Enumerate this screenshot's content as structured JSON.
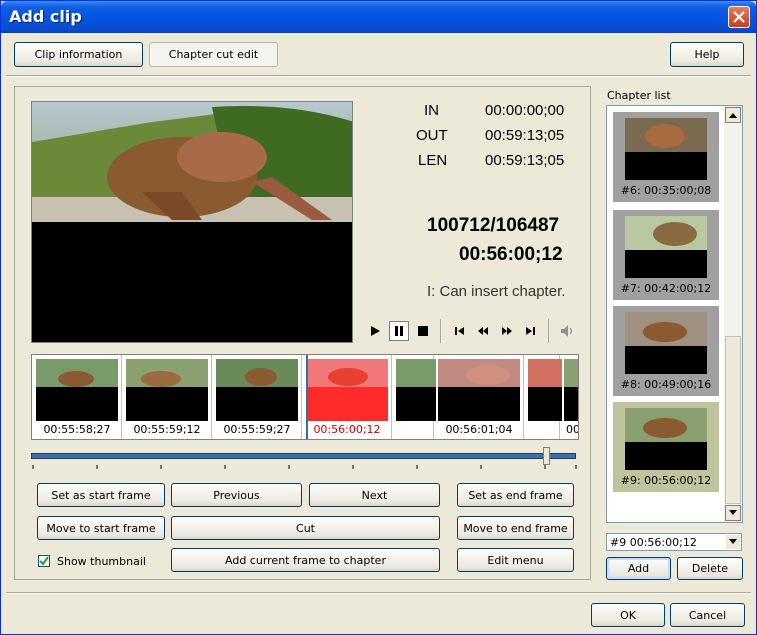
{
  "window": {
    "title": "Add clip"
  },
  "tabs": {
    "clip_info": "Clip information",
    "chapter_cut": "Chapter cut edit"
  },
  "help_label": "Help",
  "timecodes": {
    "in_label": "IN",
    "in_value": "00:00:00;00",
    "out_label": "OUT",
    "out_value": "00:59:13;05",
    "len_label": "LEN",
    "len_value": "00:59:13;05"
  },
  "frame_counter": "100712/106487",
  "current_time": "00:56:00;12",
  "status_text": "I: Can insert chapter.",
  "filmstrip": [
    {
      "time": "00:55:58;27",
      "current": false
    },
    {
      "time": "00:55:59;12",
      "current": false
    },
    {
      "time": "00:55:59;27",
      "current": false
    },
    {
      "time": "00:56:00;12",
      "current": true
    },
    {
      "time": "",
      "current": false
    },
    {
      "time": "00:56:01;04",
      "current": false
    },
    {
      "time": "",
      "current": false
    },
    {
      "time": "00",
      "current": false
    }
  ],
  "buttons": {
    "set_start": "Set as start frame",
    "previous": "Previous",
    "next": "Next",
    "set_end": "Set as end frame",
    "move_start": "Move to start frame",
    "cut": "Cut",
    "move_end": "Move to end frame",
    "add_current": "Add current frame to chapter",
    "edit_menu": "Edit menu",
    "add": "Add",
    "delete": "Delete",
    "ok": "OK",
    "cancel": "Cancel"
  },
  "show_thumbnail": {
    "label": "Show thumbnail",
    "checked": true
  },
  "chapter_list": {
    "label": "Chapter list",
    "items": [
      {
        "label": "#6: 00:35:00;08",
        "selected": false
      },
      {
        "label": "#7: 00:42:00;12",
        "selected": false
      },
      {
        "label": "#8: 00:49:00;16",
        "selected": false
      },
      {
        "label": "#9: 00:56:00;12",
        "selected": true
      }
    ]
  },
  "chapter_select": {
    "value": "#9   00:56:00;12"
  },
  "colors": {
    "title_bar": "#0054e3",
    "current_frame_text": "#d40000",
    "progress": "#3a6ea5",
    "selected_chapter": "#c0c49c"
  },
  "playhead_fraction": 0.946
}
